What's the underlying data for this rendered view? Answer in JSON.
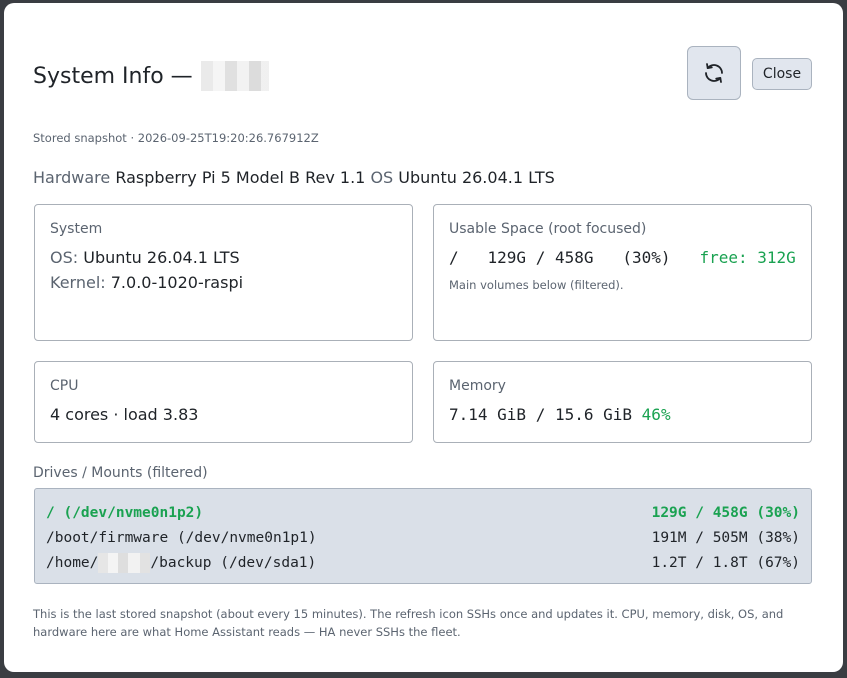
{
  "dialog": {
    "title": "System Info —",
    "refresh_icon": "refresh-icon",
    "close_label": "Close"
  },
  "snapshot": "Stored snapshot · 2026-09-25T19:20:26.767912Z",
  "summary": {
    "hardware_label": "Hardware",
    "hardware_value": "Raspberry Pi 5 Model B Rev 1.1",
    "os_label": "OS",
    "os_value": "Ubuntu 26.04.1 LTS"
  },
  "system_card": {
    "label": "System",
    "os_label": "OS:",
    "os_value": "Ubuntu 26.04.1 LTS",
    "kernel_label": "Kernel:",
    "kernel_value": "7.0.0-1020-raspi"
  },
  "usable_card": {
    "label": "Usable Space (root focused)",
    "line": "/   129G / 458G   (30%)",
    "free": "free: 312G",
    "note": "Main volumes below (filtered)."
  },
  "cpu_card": {
    "label": "CPU",
    "value": "4 cores · load 3.83"
  },
  "memory_card": {
    "label": "Memory",
    "value": "7.14 GiB / 15.6 GiB",
    "percent": "46%"
  },
  "drives": {
    "label": "Drives / Mounts (filtered)",
    "rows": [
      {
        "mount": "/ (/dev/nvme0n1p2)",
        "usage": "129G / 458G (30%)"
      },
      {
        "mount": "/boot/firmware (/dev/nvme0n1p1)",
        "usage": "191M / 505M (38%)"
      },
      {
        "mount_prefix": "/home/",
        "mount_suffix": "/backup (/dev/sda1)",
        "usage": "1.2T / 1.8T (67%)"
      }
    ]
  },
  "footer": "This is the last stored snapshot (about every 15 minutes). The refresh icon SSHs once and updates it. CPU, memory, disk, OS, and hardware here are what Home Assistant reads — HA never SSHs the fleet.",
  "colors": {
    "accent_green": "#1aa251",
    "button_bg": "#e1e6ee",
    "drives_bg": "#dae0e8"
  }
}
